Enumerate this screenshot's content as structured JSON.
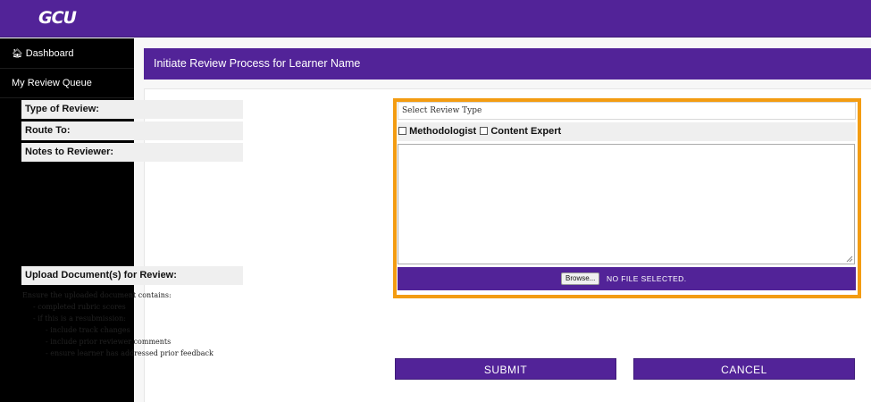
{
  "header": {
    "logo": "GCU"
  },
  "sidebar": {
    "items": [
      {
        "label": "Dashboard",
        "icon": "home-icon"
      },
      {
        "label": "My Review Queue"
      }
    ]
  },
  "page": {
    "title": "Initiate Review Process for Learner Name"
  },
  "form": {
    "type_of_review_label": "Type of Review:",
    "route_to_label": "Route To:",
    "notes_label": "Notes to Reviewer:",
    "upload_label": "Upload Document(s) for Review:",
    "review_type_select": "Select Review Type",
    "route_options": [
      "Methodologist",
      "Content Expert"
    ],
    "notes_value": "",
    "browse_label": "Browse...",
    "file_status": "NO FILE SELECTED."
  },
  "instructions": [
    "Ensure the uploaded document contains:",
    "- completed rubric scores",
    "- if this is a resubmission:",
    "- include track changes",
    "- include prior reviewer comments",
    "- ensure learner has addressed prior feedback"
  ],
  "buttons": {
    "submit": "SUBMIT",
    "cancel": "CANCEL"
  },
  "colors": {
    "brand": "#522398",
    "highlight": "#f39c12",
    "sidebar": "#000000"
  }
}
